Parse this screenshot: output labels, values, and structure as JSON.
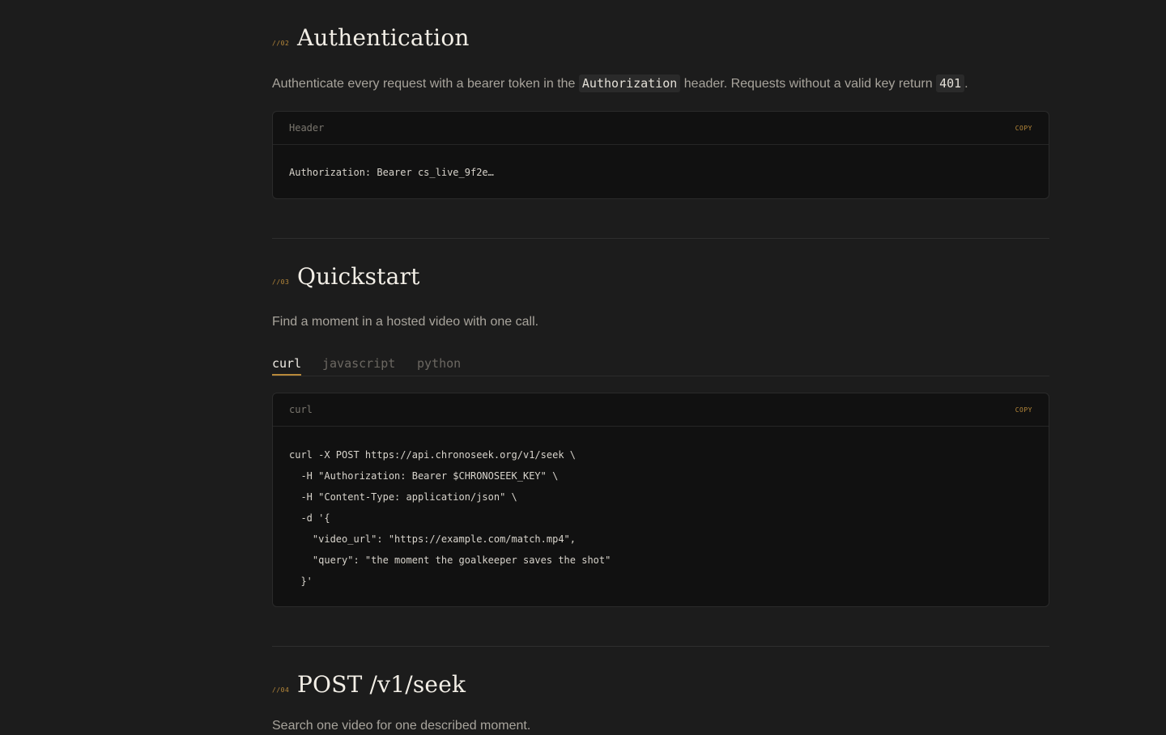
{
  "sections": {
    "auth": {
      "num": "//02",
      "title": "Authentication",
      "lead_before": "Authenticate every request with a bearer token in the",
      "lead_code1": "Authorization",
      "lead_middle": "header. Requests without a valid key return",
      "lead_code2": "401",
      "lead_after": ".",
      "code": {
        "label": "Header",
        "copy": "COPY",
        "lines": [
          "Authorization: Bearer cs_live_9f2e…"
        ]
      }
    },
    "quickstart": {
      "num": "//03",
      "title": "Quickstart",
      "lead": "Find a moment in a hosted video with one call.",
      "tabs": [
        "curl",
        "javascript",
        "python"
      ],
      "active_tab": "curl",
      "code": {
        "label": "curl",
        "copy": "COPY",
        "lines": [
          "curl -X POST https://api.chronoseek.org/v1/seek \\",
          "  -H \"Authorization: Bearer $CHRONOSEEK_KEY\" \\",
          "  -H \"Content-Type: application/json\" \\",
          "  -d '{",
          "    \"video_url\": \"https://example.com/match.mp4\",",
          "    \"query\": \"the moment the goalkeeper saves the shot\"",
          "  }'"
        ]
      }
    },
    "seek": {
      "num": "//04",
      "title": "POST /v1/seek",
      "lead": "Search one video for one described moment."
    }
  },
  "colors": {
    "background": "#1c1c1c",
    "accent": "#b8893a",
    "code_bg": "#111111"
  }
}
